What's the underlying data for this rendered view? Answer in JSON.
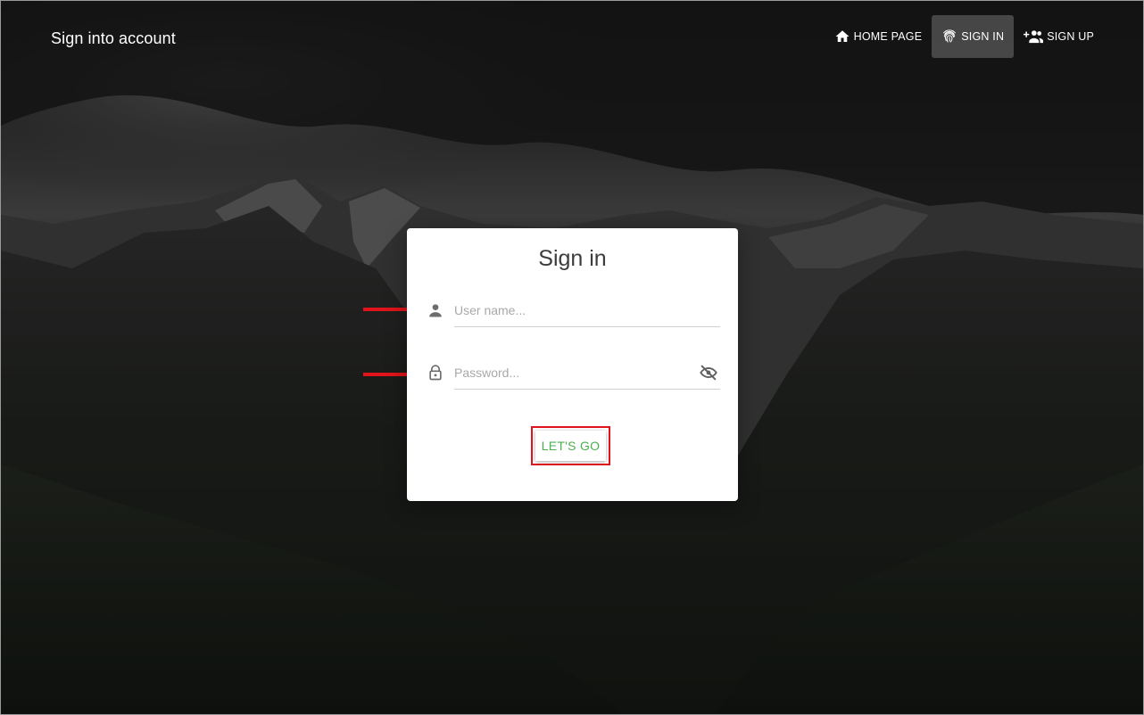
{
  "header": {
    "title": "Sign into account",
    "nav": [
      {
        "label": "HOME PAGE",
        "icon": "home-icon",
        "active": false
      },
      {
        "label": "SIGN IN",
        "icon": "fingerprint-icon",
        "active": true
      },
      {
        "label": "SIGN UP",
        "icon": "add-group-icon",
        "active": false
      }
    ]
  },
  "signin": {
    "title": "Sign in",
    "username_placeholder": "User name...",
    "password_placeholder": "Password...",
    "submit_label": "LET'S GO"
  },
  "colors": {
    "accent": "#4caf50",
    "annotation": "#e0141a",
    "nav_active_bg": "rgba(255,255,255,0.22)"
  }
}
